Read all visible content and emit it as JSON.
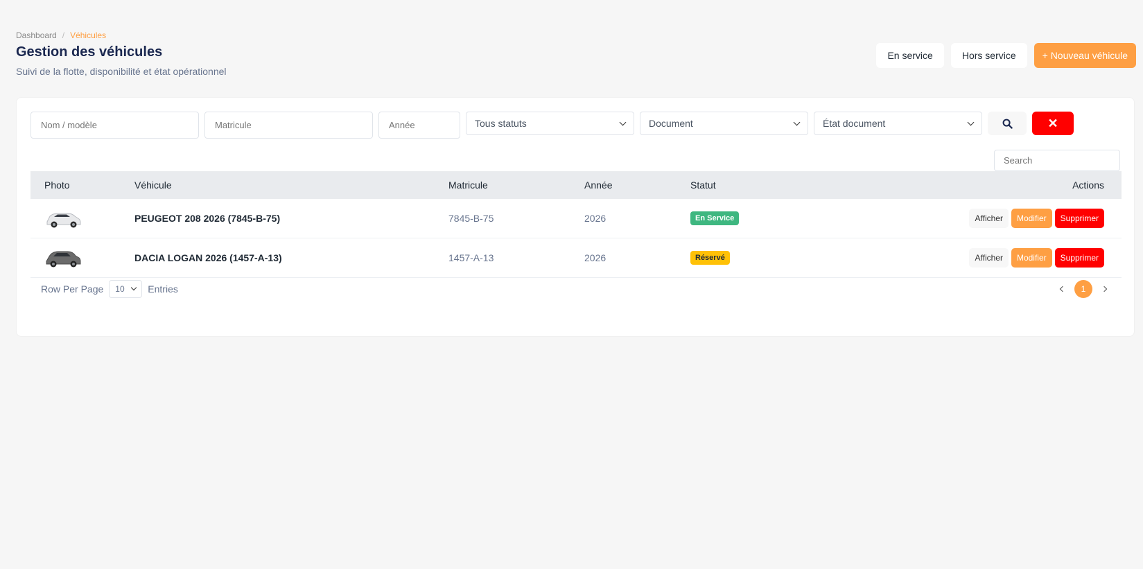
{
  "breadcrumb": {
    "home": "Dashboard",
    "separator": "/",
    "current": "Véhicules"
  },
  "header": {
    "title": "Gestion des véhicules",
    "subtitle": "Suivi de la flotte, disponibilité et état opérationnel",
    "btn_in_service": "En service",
    "btn_out_service": "Hors service",
    "btn_new": "+ Nouveau véhicule"
  },
  "filters": {
    "name_placeholder": "Nom / modèle",
    "plate_placeholder": "Matricule",
    "year_placeholder": "Année",
    "status_select": "Tous statuts",
    "document_select": "Document",
    "doc_state_select": "État document",
    "clear_label": "✕"
  },
  "table": {
    "search_placeholder": "Search",
    "headers": {
      "photo": "Photo",
      "vehicle": "Véhicule",
      "plate": "Matricule",
      "year": "Année",
      "status": "Statut",
      "actions": "Actions"
    },
    "rows": [
      {
        "vehicle": "PEUGEOT 208 2026 (7845-B-75)",
        "plate": "7845-B-75",
        "year": "2026",
        "status": "En Service",
        "car_color": "#e8e9eb"
      },
      {
        "vehicle": "DACIA LOGAN 2026 (1457-A-13)",
        "plate": "1457-A-13",
        "year": "2026",
        "status": "Réservé",
        "car_color": "#6b6b6b"
      }
    ],
    "actions": {
      "view": "Afficher",
      "edit": "Modifier",
      "delete": "Supprimer"
    }
  },
  "footer": {
    "rows_label": "Row Per Page",
    "rows_value": "10",
    "entries_label": "Entries",
    "current_page": "1"
  },
  "colors": {
    "accent": "#fe9f43",
    "danger": "#ff0000",
    "success": "#3eb780",
    "warning": "#ffc107"
  },
  "icons": {
    "search": "search-icon",
    "clear": "close-icon"
  }
}
